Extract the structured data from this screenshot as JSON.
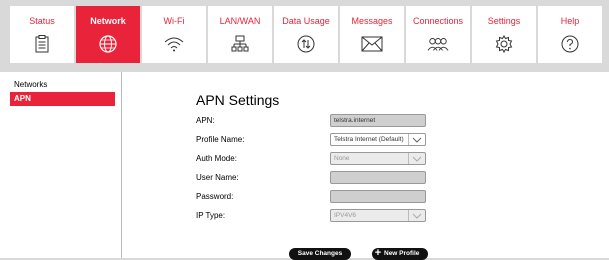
{
  "nav": {
    "tabs": [
      {
        "label": "Status",
        "icon": "clipboard-icon",
        "active": false
      },
      {
        "label": "Network",
        "icon": "globe-icon",
        "active": true
      },
      {
        "label": "Wi-Fi",
        "icon": "wifi-icon",
        "active": false
      },
      {
        "label": "LAN/WAN",
        "icon": "network-tree-icon",
        "active": false
      },
      {
        "label": "Data Usage",
        "icon": "data-usage-icon",
        "active": false
      },
      {
        "label": "Messages",
        "icon": "envelope-icon",
        "active": false
      },
      {
        "label": "Connections",
        "icon": "users-icon",
        "active": false
      },
      {
        "label": "Settings",
        "icon": "gear-icon",
        "active": false
      },
      {
        "label": "Help",
        "icon": "help-icon",
        "active": false
      }
    ]
  },
  "sidebar": {
    "items": [
      {
        "label": "Networks",
        "active": false
      },
      {
        "label": "APN",
        "active": true
      }
    ]
  },
  "apn": {
    "title": "APN Settings",
    "apn_label": "APN:",
    "apn_value": "telstra.internet",
    "profile_label": "Profile Name:",
    "profile_value": "Telstra Internet (Default)",
    "auth_label": "Auth Mode:",
    "auth_value": "None",
    "username_label": "User Name:",
    "username_value": "",
    "password_label": "Password:",
    "password_value": "",
    "iptype_label": "IP Type:",
    "iptype_value": "IPV4V6"
  },
  "buttons": {
    "save": "Save Changes",
    "new_profile": "New Profile"
  },
  "colors": {
    "accent": "#e8233a"
  }
}
